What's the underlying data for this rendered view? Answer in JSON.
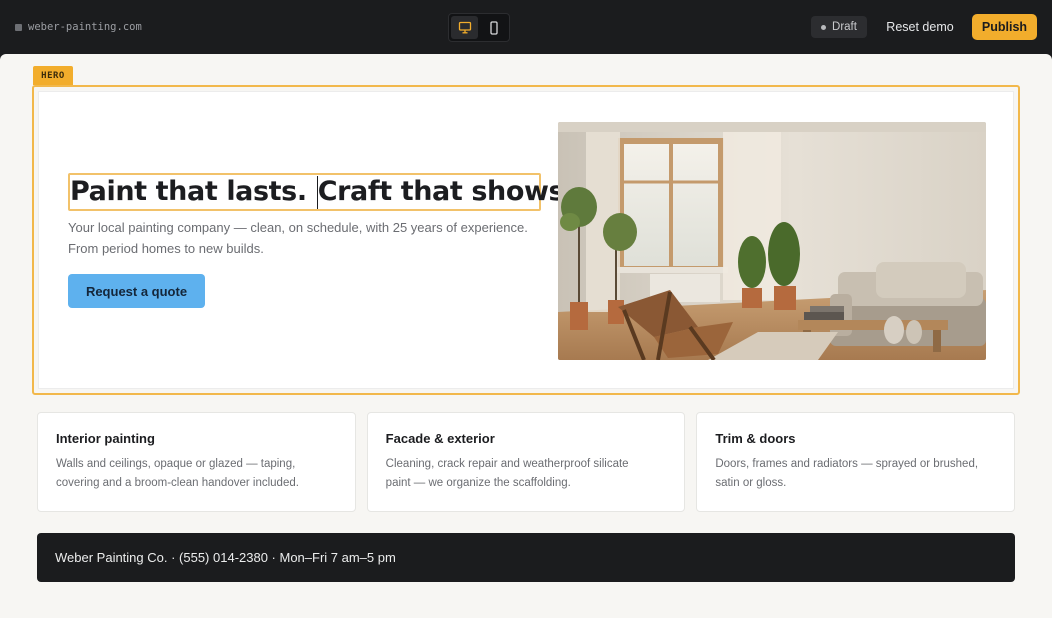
{
  "toolbar": {
    "url": "weber-painting.com",
    "status": "Draft",
    "reset_label": "Reset demo",
    "publish_label": "Publish",
    "devices": [
      {
        "icon": "desktop-icon",
        "active": true
      },
      {
        "icon": "mobile-icon",
        "active": false
      }
    ],
    "accent_color": "#f2ad2c"
  },
  "editor": {
    "section_label": "HERO"
  },
  "hero": {
    "title_part1": "Paint that lasts.",
    "title_part2": "Craft that shows.",
    "subtitle_line1": "Your local painting company — clean, on schedule, with 25 years of experience.",
    "subtitle_line2": "From period homes to new builds.",
    "cta_label": "Request a quote",
    "cta_color": "#5eb1ee",
    "image": "living-room-photo"
  },
  "services": [
    {
      "title": "Interior painting",
      "line1": "Walls and ceilings, opaque or glazed — taping,",
      "line2": "covering and a broom-clean handover included."
    },
    {
      "title": "Facade & exterior",
      "line1": "Cleaning, crack repair and weatherproof silicate",
      "line2": "paint — we organize the scaffolding."
    },
    {
      "title": "Trim & doors",
      "line1": "Doors, frames and radiators — sprayed or brushed,",
      "line2": "satin or gloss."
    }
  ],
  "footer": {
    "text": "Weber Painting Co. · (555) 014-2380 · Mon–Fri 7 am–5 pm"
  }
}
